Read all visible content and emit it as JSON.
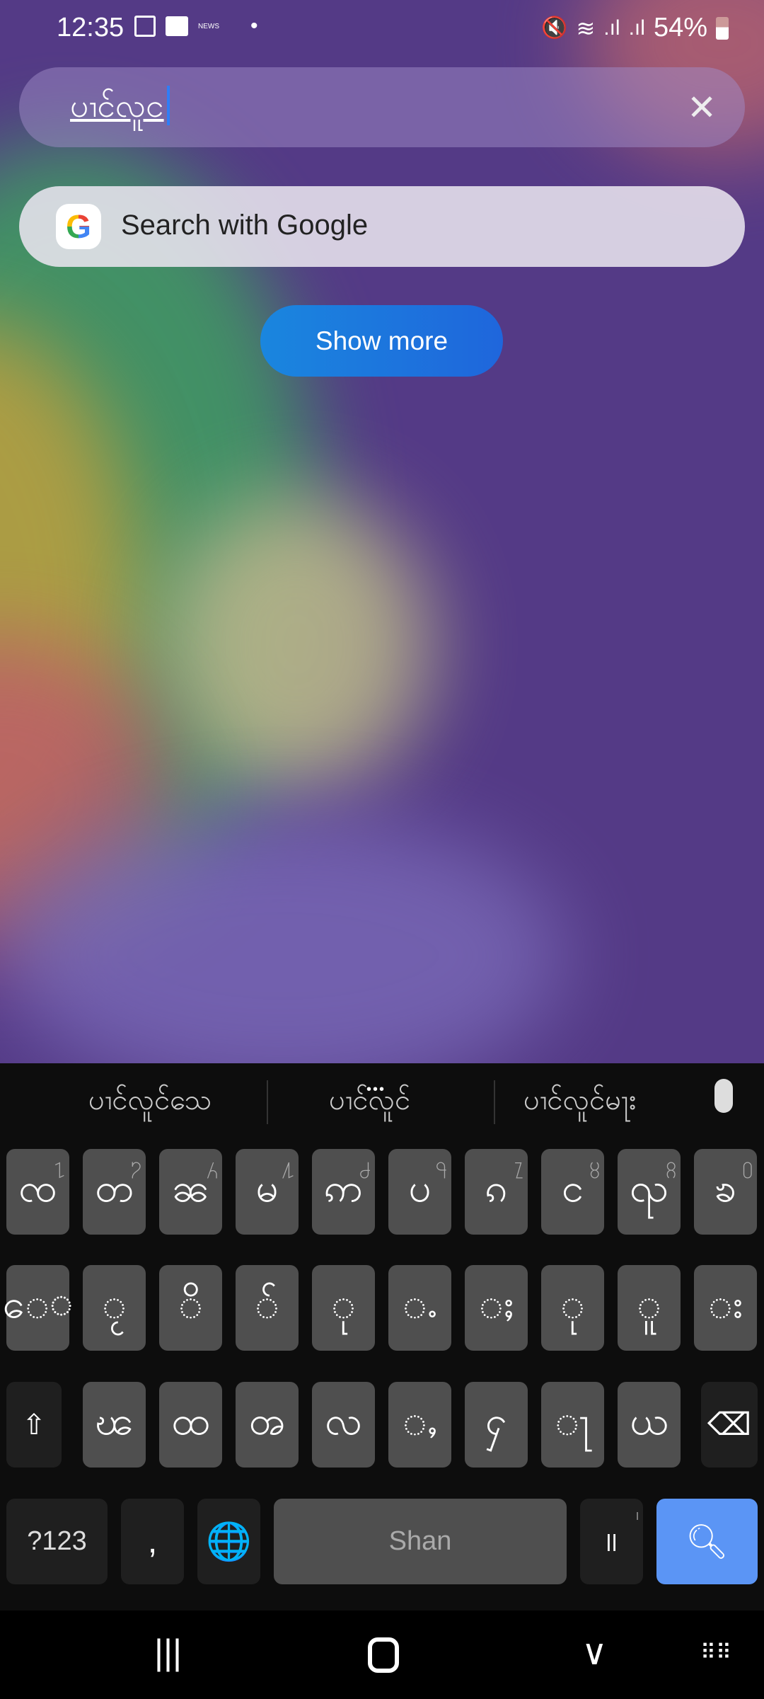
{
  "status_bar": {
    "time": "12:35",
    "battery": "54%",
    "icons": [
      "gallery-icon",
      "message-icon",
      "bbc-news-icon",
      "dot-icon",
      "mute-vibrate-icon",
      "wifi-icon",
      "signal-icon",
      "signal-icon",
      "battery-icon"
    ],
    "news_label": "NEWS"
  },
  "search": {
    "query": "ပၢင်လူင",
    "clear_icon": "close-icon"
  },
  "google": {
    "label": "Search with Google",
    "logo": "G"
  },
  "show_more": {
    "label": "Show more"
  },
  "keyboard": {
    "suggestions": [
      "ပၢင်လူင်သေ",
      "ပၢင်လူင်",
      "ပၢင်လူင်မႃး"
    ],
    "more_indicator": "•••",
    "row1": [
      {
        "k": "ၸ",
        "n": "႑"
      },
      {
        "k": "တ",
        "n": "႒"
      },
      {
        "k": "ၼ",
        "n": "႓"
      },
      {
        "k": "မ",
        "n": "႔"
      },
      {
        "k": "ဢ",
        "n": "႕"
      },
      {
        "k": "ပ",
        "n": "႖"
      },
      {
        "k": "ၵ",
        "n": "႗"
      },
      {
        "k": "င",
        "n": "႘"
      },
      {
        "k": "ၺ",
        "n": "႙"
      },
      {
        "k": "ၶ",
        "n": "႐"
      }
    ],
    "row2": [
      "ေ◌",
      "◌ႂ",
      "◌ိ",
      "◌်",
      "◌ု",
      "◌ႉ",
      "◌ႈ",
      "◌ု",
      "◌ူ",
      "◌း"
    ],
    "row3": [
      "ၽ",
      "ထ",
      "ၻ",
      "လ",
      "◌ႇ",
      "ႁ",
      "◌ႃ",
      "ယ"
    ],
    "symbols_label": "?123",
    "comma": ",",
    "space_label": "Shan",
    "section_mark": "။",
    "section_sub": "၊"
  },
  "accent_color": "#5b95f5"
}
